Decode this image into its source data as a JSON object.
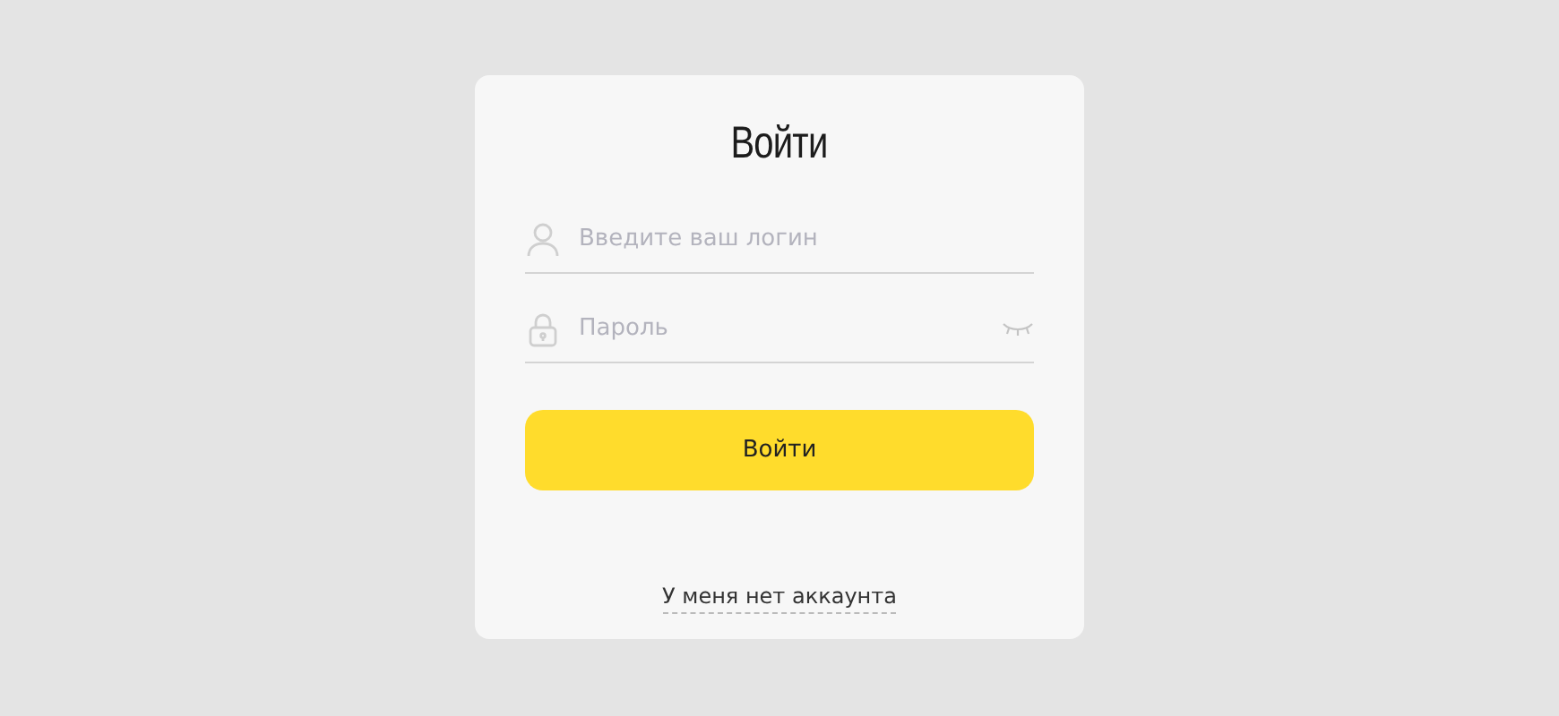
{
  "title": "Войти",
  "fields": [
    {
      "kind": "login",
      "placeholder": "Введите ваш логин"
    },
    {
      "kind": "password",
      "placeholder": "Пароль"
    }
  ],
  "submit": "Войти",
  "link": "У меня нет аккаунта"
}
